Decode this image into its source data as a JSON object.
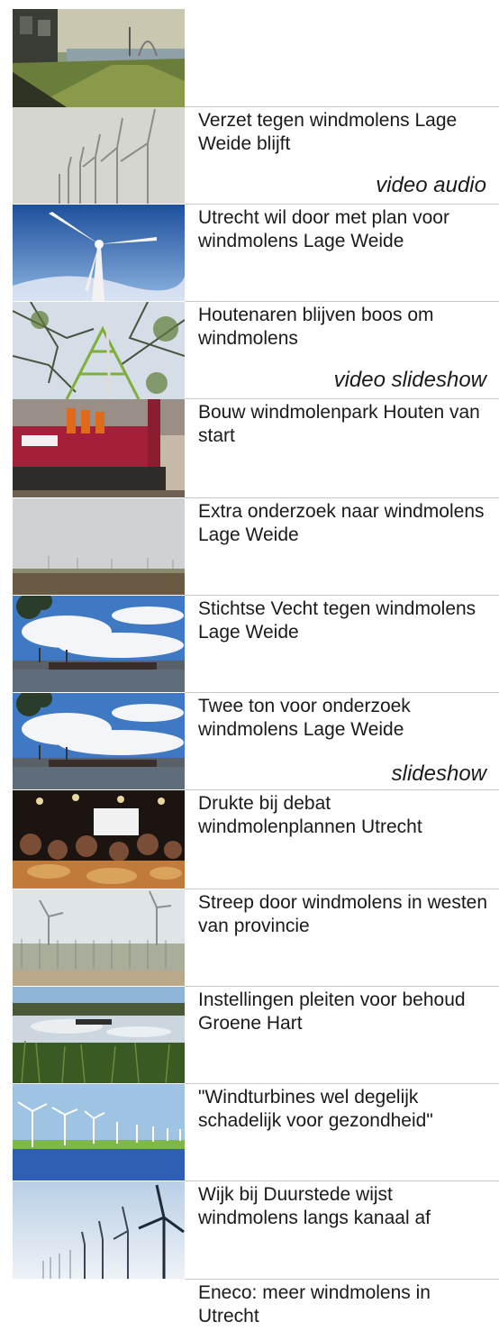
{
  "articles": [
    {
      "title": "",
      "thumb": "waterfront-path-photo",
      "media": []
    },
    {
      "title": "Verzet tegen windmolens Lage Weide blijft",
      "thumb": "foggy-turbines-photo",
      "media": [
        "video",
        "audio"
      ]
    },
    {
      "title": "Utrecht wil door met plan voor windmolens Lage Weide",
      "thumb": "turbine-blue-sky-photo",
      "media": []
    },
    {
      "title": "Houtenaren blijven boos om windmolens",
      "thumb": "turbine-tree-branches-photo",
      "media": [
        "video",
        "slideshow"
      ]
    },
    {
      "title": "Bouw windmolenpark Houten van start",
      "thumb": "construction-crane-photo",
      "media": []
    },
    {
      "title": "Extra onderzoek naar windmolens Lage Weide",
      "thumb": "hazy-field-turbines-photo",
      "media": []
    },
    {
      "title": "Stichtse Vecht tegen windmolens Lage Weide",
      "thumb": "harbor-clouds-photo",
      "media": []
    },
    {
      "title": "Twee ton voor onderzoek windmolens Lage Weide",
      "thumb": "harbor-clouds-photo",
      "media": [
        "slideshow"
      ]
    },
    {
      "title": "Drukte bij debat windmolenplannen Utrecht",
      "thumb": "crowded-hall-photo",
      "media": []
    },
    {
      "title": "Streep door windmolens in westen van provincie",
      "thumb": "turbines-tree-line-photo",
      "media": []
    },
    {
      "title": "Instellingen pleiten voor behoud Groene Hart",
      "thumb": "wetland-reeds-photo",
      "media": []
    },
    {
      "title": "\"Windturbines wel degelijk schadelijk voor gezondheid\"",
      "thumb": "turbines-sea-row-photo",
      "media": []
    },
    {
      "title": "Wijk bij Duurstede wijst windmolens langs kanaal af",
      "thumb": "turbine-row-sky-photo",
      "media": []
    },
    {
      "title": "Eneco: meer windmolens in Utrecht",
      "thumb": "",
      "media": []
    }
  ]
}
